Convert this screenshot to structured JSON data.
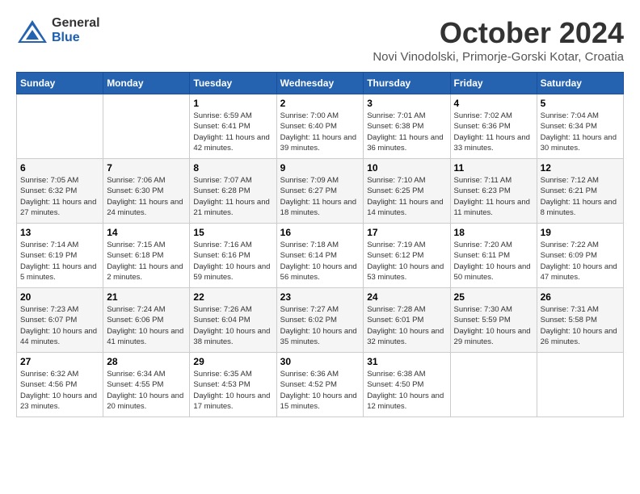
{
  "logo": {
    "general": "General",
    "blue": "Blue"
  },
  "title": "October 2024",
  "location": "Novi Vinodolski, Primorje-Gorski Kotar, Croatia",
  "weekdays": [
    "Sunday",
    "Monday",
    "Tuesday",
    "Wednesday",
    "Thursday",
    "Friday",
    "Saturday"
  ],
  "weeks": [
    [
      {
        "day": "",
        "detail": ""
      },
      {
        "day": "",
        "detail": ""
      },
      {
        "day": "1",
        "detail": "Sunrise: 6:59 AM\nSunset: 6:41 PM\nDaylight: 11 hours and 42 minutes."
      },
      {
        "day": "2",
        "detail": "Sunrise: 7:00 AM\nSunset: 6:40 PM\nDaylight: 11 hours and 39 minutes."
      },
      {
        "day": "3",
        "detail": "Sunrise: 7:01 AM\nSunset: 6:38 PM\nDaylight: 11 hours and 36 minutes."
      },
      {
        "day": "4",
        "detail": "Sunrise: 7:02 AM\nSunset: 6:36 PM\nDaylight: 11 hours and 33 minutes."
      },
      {
        "day": "5",
        "detail": "Sunrise: 7:04 AM\nSunset: 6:34 PM\nDaylight: 11 hours and 30 minutes."
      }
    ],
    [
      {
        "day": "6",
        "detail": "Sunrise: 7:05 AM\nSunset: 6:32 PM\nDaylight: 11 hours and 27 minutes."
      },
      {
        "day": "7",
        "detail": "Sunrise: 7:06 AM\nSunset: 6:30 PM\nDaylight: 11 hours and 24 minutes."
      },
      {
        "day": "8",
        "detail": "Sunrise: 7:07 AM\nSunset: 6:28 PM\nDaylight: 11 hours and 21 minutes."
      },
      {
        "day": "9",
        "detail": "Sunrise: 7:09 AM\nSunset: 6:27 PM\nDaylight: 11 hours and 18 minutes."
      },
      {
        "day": "10",
        "detail": "Sunrise: 7:10 AM\nSunset: 6:25 PM\nDaylight: 11 hours and 14 minutes."
      },
      {
        "day": "11",
        "detail": "Sunrise: 7:11 AM\nSunset: 6:23 PM\nDaylight: 11 hours and 11 minutes."
      },
      {
        "day": "12",
        "detail": "Sunrise: 7:12 AM\nSunset: 6:21 PM\nDaylight: 11 hours and 8 minutes."
      }
    ],
    [
      {
        "day": "13",
        "detail": "Sunrise: 7:14 AM\nSunset: 6:19 PM\nDaylight: 11 hours and 5 minutes."
      },
      {
        "day": "14",
        "detail": "Sunrise: 7:15 AM\nSunset: 6:18 PM\nDaylight: 11 hours and 2 minutes."
      },
      {
        "day": "15",
        "detail": "Sunrise: 7:16 AM\nSunset: 6:16 PM\nDaylight: 10 hours and 59 minutes."
      },
      {
        "day": "16",
        "detail": "Sunrise: 7:18 AM\nSunset: 6:14 PM\nDaylight: 10 hours and 56 minutes."
      },
      {
        "day": "17",
        "detail": "Sunrise: 7:19 AM\nSunset: 6:12 PM\nDaylight: 10 hours and 53 minutes."
      },
      {
        "day": "18",
        "detail": "Sunrise: 7:20 AM\nSunset: 6:11 PM\nDaylight: 10 hours and 50 minutes."
      },
      {
        "day": "19",
        "detail": "Sunrise: 7:22 AM\nSunset: 6:09 PM\nDaylight: 10 hours and 47 minutes."
      }
    ],
    [
      {
        "day": "20",
        "detail": "Sunrise: 7:23 AM\nSunset: 6:07 PM\nDaylight: 10 hours and 44 minutes."
      },
      {
        "day": "21",
        "detail": "Sunrise: 7:24 AM\nSunset: 6:06 PM\nDaylight: 10 hours and 41 minutes."
      },
      {
        "day": "22",
        "detail": "Sunrise: 7:26 AM\nSunset: 6:04 PM\nDaylight: 10 hours and 38 minutes."
      },
      {
        "day": "23",
        "detail": "Sunrise: 7:27 AM\nSunset: 6:02 PM\nDaylight: 10 hours and 35 minutes."
      },
      {
        "day": "24",
        "detail": "Sunrise: 7:28 AM\nSunset: 6:01 PM\nDaylight: 10 hours and 32 minutes."
      },
      {
        "day": "25",
        "detail": "Sunrise: 7:30 AM\nSunset: 5:59 PM\nDaylight: 10 hours and 29 minutes."
      },
      {
        "day": "26",
        "detail": "Sunrise: 7:31 AM\nSunset: 5:58 PM\nDaylight: 10 hours and 26 minutes."
      }
    ],
    [
      {
        "day": "27",
        "detail": "Sunrise: 6:32 AM\nSunset: 4:56 PM\nDaylight: 10 hours and 23 minutes."
      },
      {
        "day": "28",
        "detail": "Sunrise: 6:34 AM\nSunset: 4:55 PM\nDaylight: 10 hours and 20 minutes."
      },
      {
        "day": "29",
        "detail": "Sunrise: 6:35 AM\nSunset: 4:53 PM\nDaylight: 10 hours and 17 minutes."
      },
      {
        "day": "30",
        "detail": "Sunrise: 6:36 AM\nSunset: 4:52 PM\nDaylight: 10 hours and 15 minutes."
      },
      {
        "day": "31",
        "detail": "Sunrise: 6:38 AM\nSunset: 4:50 PM\nDaylight: 10 hours and 12 minutes."
      },
      {
        "day": "",
        "detail": ""
      },
      {
        "day": "",
        "detail": ""
      }
    ]
  ]
}
